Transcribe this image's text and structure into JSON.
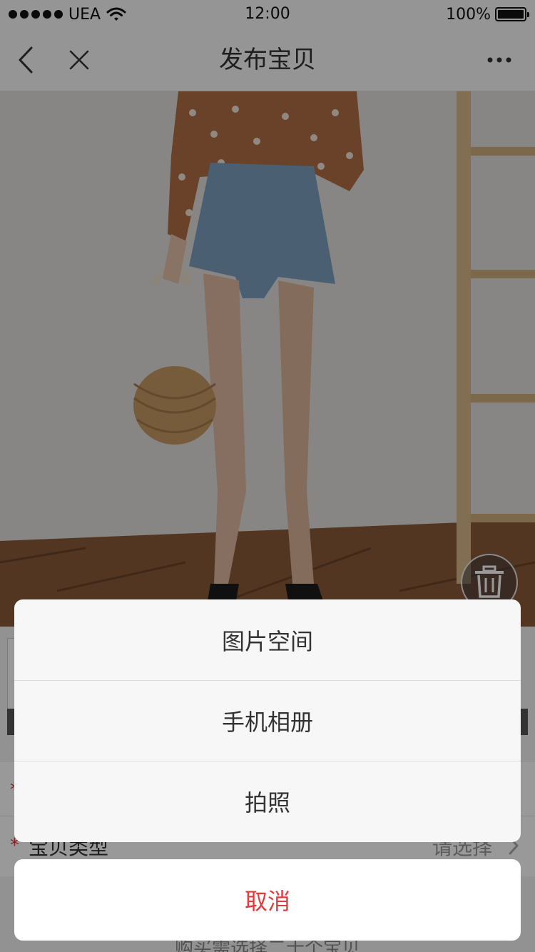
{
  "status_bar": {
    "carrier": "UEA",
    "time": "12:00",
    "battery": "100%"
  },
  "nav": {
    "title": "发布宝贝",
    "back_icon": "chevron-left-icon",
    "close_icon": "close-icon",
    "more_icon": "more-dots-icon"
  },
  "photo": {
    "description_icon": "product-photo",
    "delete_icon": "trash-icon"
  },
  "form": {
    "rows": [
      {
        "label": "",
        "value": ""
      },
      {
        "label": "宝贝类型",
        "value": "请选择"
      }
    ],
    "hint": "购买需选择二十个宝贝"
  },
  "action_sheet": {
    "options": [
      {
        "label": "图片空间"
      },
      {
        "label": "手机相册"
      },
      {
        "label": "拍照"
      }
    ],
    "cancel": "取消"
  },
  "colors": {
    "accent_red": "#e4393c",
    "sheet_bg": "#f7f7f7",
    "overlay": "rgba(0,0,0,0.4)"
  }
}
